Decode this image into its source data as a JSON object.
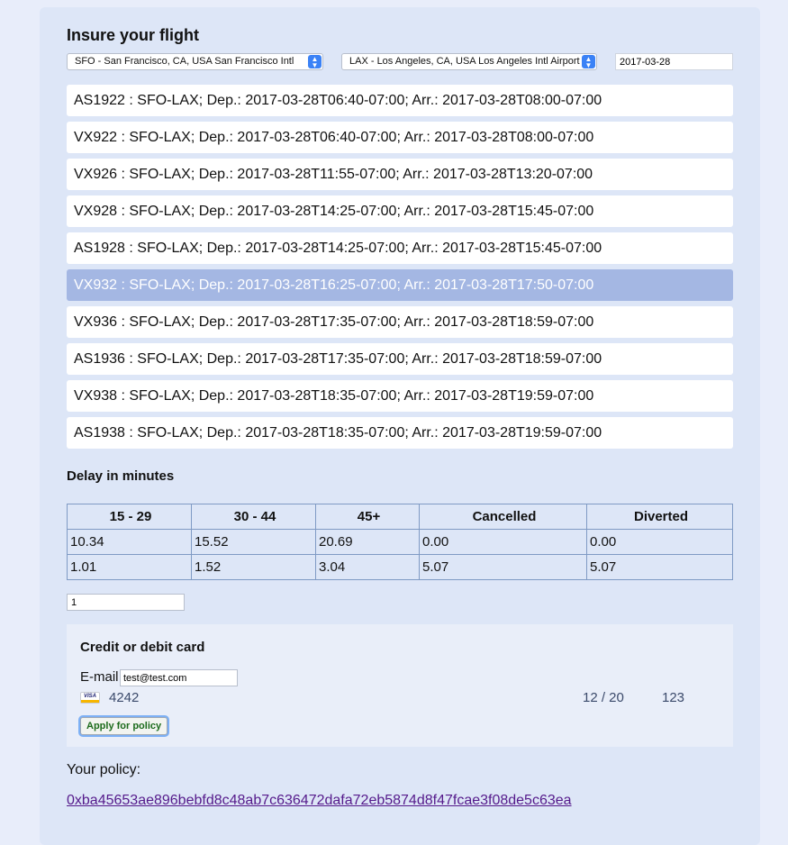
{
  "title": "Insure your flight",
  "search": {
    "origin": "SFO - San Francisco, CA, USA San Francisco Intl",
    "destination": "LAX - Los Angeles, CA, USA Los Angeles Intl Airport",
    "date": "2017-03-28"
  },
  "flights": [
    {
      "label": "AS1922 : SFO-LAX; Dep.: 2017-03-28T06:40-07:00; Arr.: 2017-03-28T08:00-07:00",
      "selected": false
    },
    {
      "label": "VX922 : SFO-LAX; Dep.: 2017-03-28T06:40-07:00; Arr.: 2017-03-28T08:00-07:00",
      "selected": false
    },
    {
      "label": "VX926 : SFO-LAX; Dep.: 2017-03-28T11:55-07:00; Arr.: 2017-03-28T13:20-07:00",
      "selected": false
    },
    {
      "label": "VX928 : SFO-LAX; Dep.: 2017-03-28T14:25-07:00; Arr.: 2017-03-28T15:45-07:00",
      "selected": false
    },
    {
      "label": "AS1928 : SFO-LAX; Dep.: 2017-03-28T14:25-07:00; Arr.: 2017-03-28T15:45-07:00",
      "selected": false
    },
    {
      "label": "VX932 : SFO-LAX; Dep.: 2017-03-28T16:25-07:00; Arr.: 2017-03-28T17:50-07:00",
      "selected": true
    },
    {
      "label": "VX936 : SFO-LAX; Dep.: 2017-03-28T17:35-07:00; Arr.: 2017-03-28T18:59-07:00",
      "selected": false
    },
    {
      "label": "AS1936 : SFO-LAX; Dep.: 2017-03-28T17:35-07:00; Arr.: 2017-03-28T18:59-07:00",
      "selected": false
    },
    {
      "label": "VX938 : SFO-LAX; Dep.: 2017-03-28T18:35-07:00; Arr.: 2017-03-28T19:59-07:00",
      "selected": false
    },
    {
      "label": "AS1938 : SFO-LAX; Dep.: 2017-03-28T18:35-07:00; Arr.: 2017-03-28T19:59-07:00",
      "selected": false
    }
  ],
  "delays": {
    "title": "Delay in minutes",
    "headers": [
      "15 - 29",
      "30 - 44",
      "45+",
      "Cancelled",
      "Diverted"
    ],
    "rows": [
      [
        "10.34",
        "15.52",
        "20.69",
        "0.00",
        "0.00"
      ],
      [
        "1.01",
        "1.52",
        "3.04",
        "5.07",
        "5.07"
      ]
    ]
  },
  "quantity": "1",
  "card": {
    "title": "Credit or debit card",
    "email_label": "E-mail",
    "email": "test@test.com",
    "brand_icon": "visa-icon",
    "brand_text": "VISA",
    "last4": "4242",
    "expiry": "12 / 20",
    "cvc": "123",
    "apply_label": "Apply for policy"
  },
  "policy": {
    "label": "Your policy:",
    "hash": "0xba45653ae896bebfd8c48ab7c636472dafa72eb5874d8f47fcae3f08de5c63ea"
  },
  "colors": {
    "page_bg": "#e8edfa",
    "panel_bg": "#dde6f7",
    "selected_row": "#a4b7e3",
    "select_accent": "#3b82f6",
    "link": "#551a8b",
    "button_text": "#1c6b1c"
  }
}
